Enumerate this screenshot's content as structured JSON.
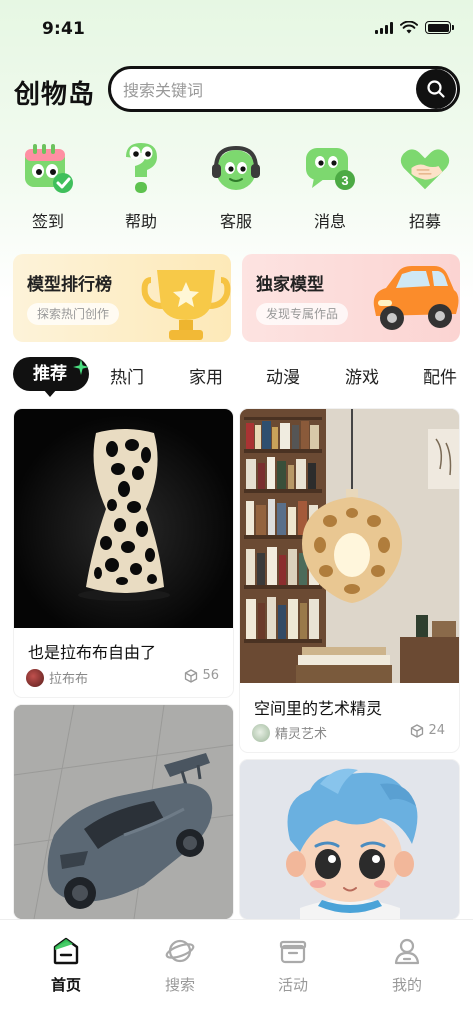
{
  "status_bar": {
    "time": "9:41"
  },
  "header": {
    "logo": "创物岛",
    "search_placeholder": "搜索关键词"
  },
  "quick_actions": [
    {
      "label": "签到",
      "icon": "calendar-check-icon"
    },
    {
      "label": "帮助",
      "icon": "question-mark-icon"
    },
    {
      "label": "客服",
      "icon": "headset-icon"
    },
    {
      "label": "消息",
      "icon": "chat-bubble-icon",
      "badge": "3"
    },
    {
      "label": "招募",
      "icon": "handshake-heart-icon"
    }
  ],
  "banners": [
    {
      "title": "模型排行榜",
      "subtitle": "探索热门创作",
      "icon": "trophy-icon"
    },
    {
      "title": "独家模型",
      "subtitle": "发现专属作品",
      "icon": "toy-car-icon"
    }
  ],
  "tabs": {
    "active": "推荐",
    "items": [
      "热门",
      "家用",
      "动漫",
      "游戏",
      "配件"
    ]
  },
  "cards": [
    {
      "title": "也是拉布布自由了",
      "author": "拉布布",
      "count": "56"
    },
    {
      "title": "空间里的艺术精灵",
      "author": "精灵艺术",
      "count": "24"
    },
    {
      "title": "",
      "author": "",
      "count": ""
    },
    {
      "title": "",
      "author": "",
      "count": ""
    }
  ],
  "bottom_nav": [
    {
      "label": "首页",
      "icon": "home-icon",
      "active": true
    },
    {
      "label": "搜索",
      "icon": "planet-icon"
    },
    {
      "label": "活动",
      "icon": "gift-box-icon"
    },
    {
      "label": "我的",
      "icon": "user-icon"
    }
  ],
  "colors": {
    "accent": "#22c55e",
    "dark": "#111111",
    "muted": "#999999"
  }
}
